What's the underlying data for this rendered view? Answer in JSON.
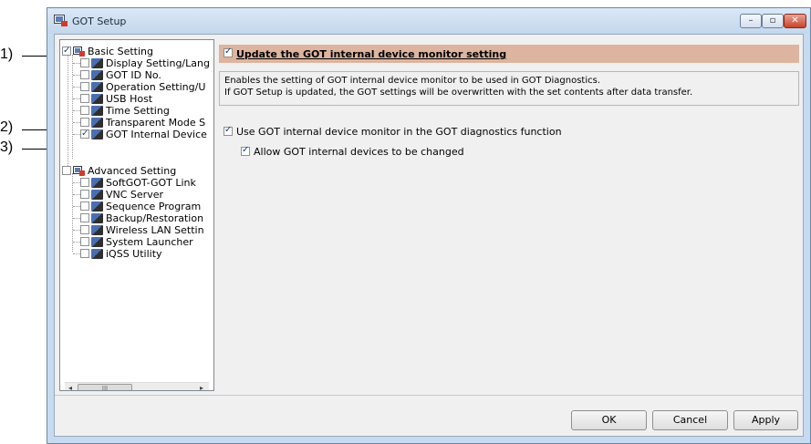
{
  "callouts": [
    "1)",
    "2)",
    "3)"
  ],
  "window": {
    "title": "GOT Setup",
    "controls": {
      "minimize": "–",
      "maximize": "▫",
      "close": "✕"
    }
  },
  "tree": {
    "basic": {
      "label": "Basic Setting",
      "checked": true,
      "items": [
        {
          "label": "Display Setting/Lang",
          "icon": "display-icon",
          "checked": false
        },
        {
          "label": "GOT ID No.",
          "icon": "id-icon",
          "checked": false
        },
        {
          "label": "Operation Setting/U",
          "icon": "operation-icon",
          "checked": false
        },
        {
          "label": "USB Host",
          "icon": "usb-icon",
          "checked": false
        },
        {
          "label": "Time Setting",
          "icon": "clock-icon",
          "checked": false
        },
        {
          "label": "Transparent Mode S",
          "icon": "transparent-icon",
          "checked": false
        },
        {
          "label": "GOT Internal Device",
          "icon": "internal-device-icon",
          "checked": true
        }
      ]
    },
    "advanced": {
      "label": "Advanced Setting",
      "checked": false,
      "items": [
        {
          "label": "SoftGOT-GOT Link",
          "icon": "link-icon",
          "checked": false
        },
        {
          "label": "VNC Server",
          "icon": "vnc-icon",
          "checked": false
        },
        {
          "label": "Sequence Program",
          "icon": "sequence-icon",
          "checked": false
        },
        {
          "label": "Backup/Restoration",
          "icon": "backup-icon",
          "checked": false
        },
        {
          "label": "Wireless LAN Settin",
          "icon": "wireless-icon",
          "checked": false
        },
        {
          "label": "System Launcher",
          "icon": "launcher-icon",
          "checked": false
        },
        {
          "label": "iQSS Utility",
          "icon": "utility-icon",
          "checked": false
        }
      ]
    },
    "scrollbar": {
      "left": "◂",
      "right": "▸",
      "thumb": "III"
    }
  },
  "main": {
    "update_checkbox": {
      "label": "Update the GOT internal device monitor setting",
      "checked": true
    },
    "description": [
      "Enables the setting of GOT internal device monitor to be used in GOT Diagnostics.",
      "If GOT Setup is updated, the GOT settings will be overwritten with the set contents after data transfer."
    ],
    "use_monitor": {
      "label": "Use GOT internal device monitor in the GOT diagnostics function",
      "checked": true
    },
    "allow_change": {
      "label": "Allow GOT internal devices to be changed",
      "checked": true
    }
  },
  "buttons": {
    "ok": "OK",
    "cancel": "Cancel",
    "apply": "Apply"
  },
  "colors": {
    "section_header": "#ddb49f",
    "window_frame": "#c6dbef",
    "checkmark": "#1a3f8a"
  }
}
